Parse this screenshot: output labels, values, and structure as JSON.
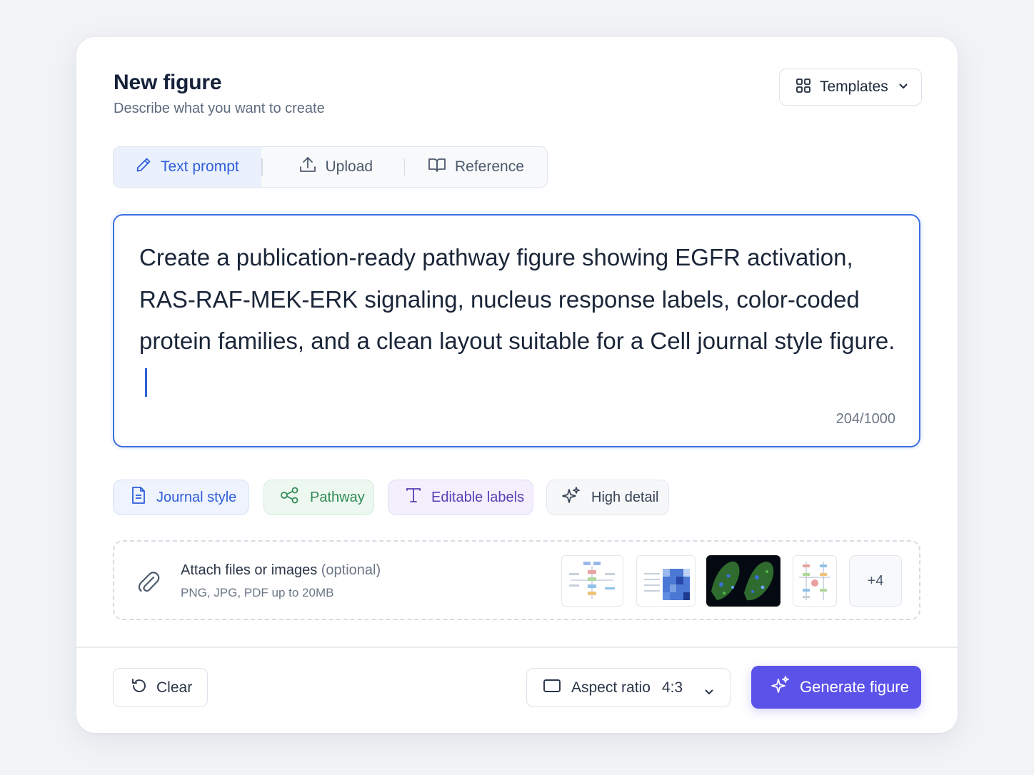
{
  "header": {
    "title": "New figure",
    "subtitle": "Describe what you want to create",
    "templates_label": "Templates"
  },
  "tabs": [
    {
      "label": "Text prompt",
      "active": true,
      "icon": "pencil-icon"
    },
    {
      "label": "Upload",
      "active": false,
      "icon": "upload-icon"
    },
    {
      "label": "Reference",
      "active": false,
      "icon": "book-icon"
    }
  ],
  "prompt": {
    "value": "Create a publication-ready pathway figure showing EGFR activation, RAS-RAF-MEK-ERK signaling, nucleus response labels, color-coded protein families, and a clean layout suitable for a Cell journal style figure.",
    "counter": "204/1000"
  },
  "chips": [
    {
      "label": "Journal style",
      "icon": "document-icon"
    },
    {
      "label": "Pathway",
      "icon": "share-nodes-icon"
    },
    {
      "label": "Editable labels",
      "icon": "text-icon"
    },
    {
      "label": "High detail",
      "icon": "sparkle-icon"
    }
  ],
  "attach": {
    "title": "Attach files or images",
    "optional": "(optional)",
    "hint": "PNG, JPG, PDF up to 20MB",
    "more": "+4"
  },
  "footer": {
    "clear_label": "Clear",
    "aspect_label": "Aspect ratio",
    "aspect_value": "4:3",
    "generate_label": "Generate figure"
  },
  "colors": {
    "accent": "#3b6fe0",
    "primary_button": "#5b52ea",
    "chip_journal": "#2f5ed8",
    "chip_pathway": "#2f8a55",
    "chip_labels": "#5a3fb5"
  }
}
